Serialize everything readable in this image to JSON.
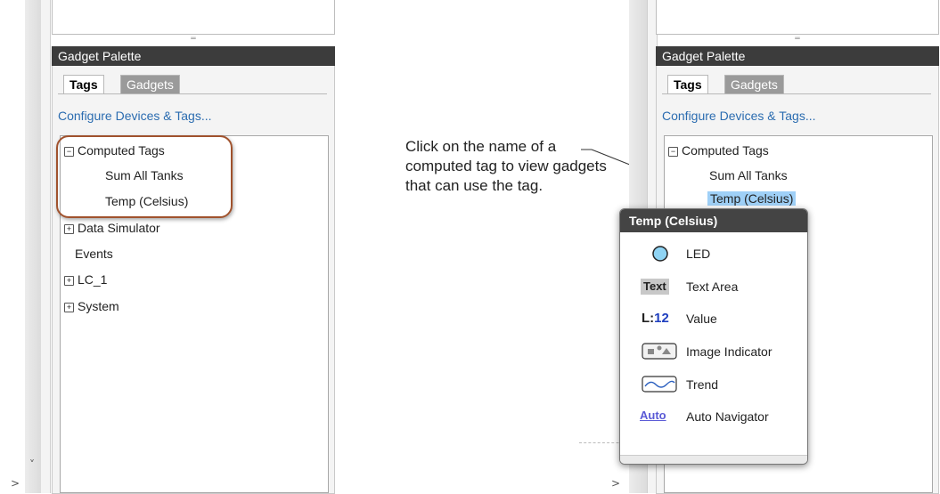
{
  "panel_left": {
    "palette_title": "Gadget Palette",
    "tabs": [
      {
        "label": "Tags",
        "active": true
      },
      {
        "label": "Gadgets",
        "active": false
      }
    ],
    "configure_link": "Configure Devices & Tags...",
    "tree": [
      {
        "label": "Computed Tags",
        "expander": "⊟",
        "expanded": true
      },
      {
        "label": "Sum All Tanks"
      },
      {
        "label": "Temp (Celsius)"
      },
      {
        "label": "Data Simulator",
        "expander": "⊞"
      },
      {
        "label": "Events"
      },
      {
        "label": "LC_1",
        "expander": "⊞"
      },
      {
        "label": "System",
        "expander": "⊞"
      }
    ],
    "scroll_down": "˅",
    "scroll_right": ">",
    "highlight_color": "#a0522d"
  },
  "callout_text": "Click on the name of a computed tag to view gadgets that can use the tag.",
  "panel_right": {
    "palette_title": "Gadget Palette",
    "tabs": [
      {
        "label": "Tags",
        "active": true
      },
      {
        "label": "Gadgets",
        "active": false
      }
    ],
    "configure_link": "Configure Devices & Tags...",
    "tree": [
      {
        "label": "Computed Tags",
        "expander": "⊟"
      },
      {
        "label": "Sum All Tanks"
      },
      {
        "label": "Temp (Celsius)",
        "selected": true
      }
    ],
    "scroll_right": ">"
  },
  "popup": {
    "title": "Temp (Celsius)",
    "items": [
      {
        "icon": "led-icon",
        "icon_text": "",
        "label": "LED"
      },
      {
        "icon": "text-area-icon",
        "icon_text": "Text",
        "label": "Text Area"
      },
      {
        "icon": "value-icon",
        "icon_text_prefix": "L:",
        "icon_text_num": "12",
        "label": "Value"
      },
      {
        "icon": "image-indicator-icon",
        "icon_text": "",
        "label": "Image Indicator"
      },
      {
        "icon": "trend-icon",
        "icon_text": "",
        "label": "Trend"
      },
      {
        "icon": "auto-navigator-icon",
        "icon_text": "Auto",
        "label": "Auto Navigator"
      }
    ]
  },
  "colors": {
    "header_bg": "#3c3c3c",
    "link": "#2b6cb0",
    "selection": "#9fd0f7",
    "value_blue": "#1f3fbf"
  }
}
